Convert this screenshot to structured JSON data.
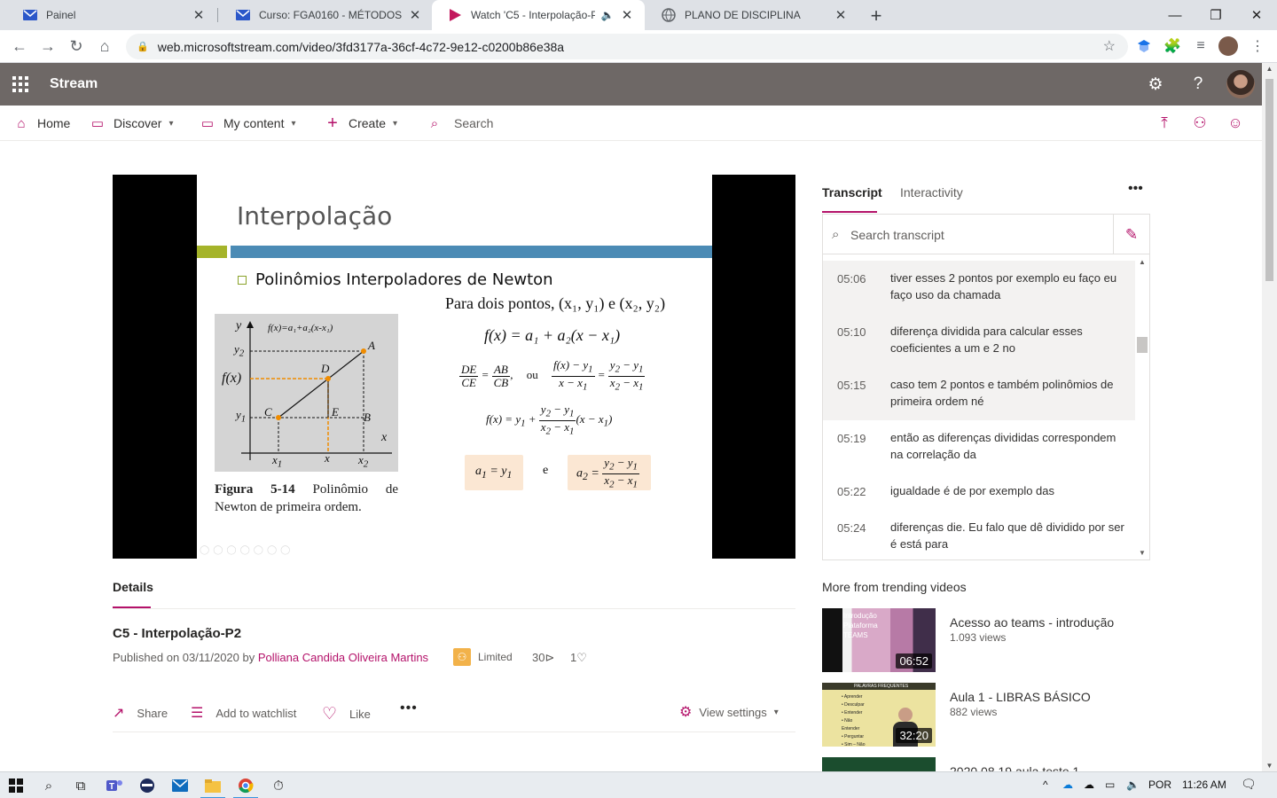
{
  "browser": {
    "tabs": [
      {
        "title": "Painel",
        "active": false
      },
      {
        "title": "Curso: FGA0160 - MÉTODOS NUMÉRICOS",
        "active": false
      },
      {
        "title": "Watch 'C5 - Interpolação-P2'",
        "active": true
      },
      {
        "title": "PLANO DE DISCIPLINA",
        "active": false
      }
    ],
    "url": "web.microsoftstream.com/video/3fd3177a-36cf-4c72-9e12-c0200b86e38a"
  },
  "header": {
    "brand": "Stream"
  },
  "nav": {
    "home": "Home",
    "discover": "Discover",
    "my_content": "My content",
    "create": "Create",
    "search": "Search"
  },
  "slide": {
    "title": "Interpolação",
    "bullet": "Polinômios Interpoladores de Newton",
    "intro": "Para dois pontos, (x₁, y₁) e (x₂, y₂)",
    "formula1": "f(x) = a₁ + a₂(x − x₁)",
    "or": "ou",
    "and": "e",
    "figure_graph_label": "f(x)=a₁+a₂(x-x₁)",
    "figure_title": "Figura 5-14",
    "figure_caption": "Polinômio de Newton de primeira ordem."
  },
  "details": {
    "tab": "Details",
    "title": "C5 - Interpolação-P2",
    "published_prefix": "Published on 03/11/2020 by",
    "author": "Polliana Candida Oliveira Martins",
    "visibility": "Limited",
    "views": "30",
    "likes": "1",
    "share": "Share",
    "watchlist": "Add to watchlist",
    "like": "Like",
    "view_settings": "View settings"
  },
  "transcript": {
    "tab_transcript": "Transcript",
    "tab_interactivity": "Interactivity",
    "search_placeholder": "Search transcript",
    "entries": [
      {
        "time": "05:06",
        "text": "tiver esses 2 pontos por exemplo eu faço eu faço uso da chamada"
      },
      {
        "time": "05:10",
        "text": "diferença dividida para calcular esses coeficientes a um e 2 no"
      },
      {
        "time": "05:15",
        "text": "caso tem 2 pontos e também polinômios de primeira ordem né"
      },
      {
        "time": "05:19",
        "text": "então as diferenças divididas correspondem na correlação da"
      },
      {
        "time": "05:22",
        "text": "igualdade é de por exemplo das"
      },
      {
        "time": "05:24",
        "text": "diferenças die. Eu falo que dê dividido por ser é está para"
      }
    ]
  },
  "trending": {
    "title": "More from trending videos",
    "videos": [
      {
        "name": "Acesso ao teams - introdução",
        "views": "1.093 views",
        "duration": "06:52"
      },
      {
        "name": "Aula 1 - LIBRAS BÁSICO",
        "views": "882 views",
        "duration": "32:20"
      },
      {
        "name": "2020 08 19 aula teste 1",
        "views": "",
        "duration": ""
      }
    ]
  },
  "taskbar": {
    "language": "POR",
    "time": "11:26 AM"
  },
  "colors": {
    "accent": "#b4126a",
    "header_bg": "#6e6866"
  }
}
